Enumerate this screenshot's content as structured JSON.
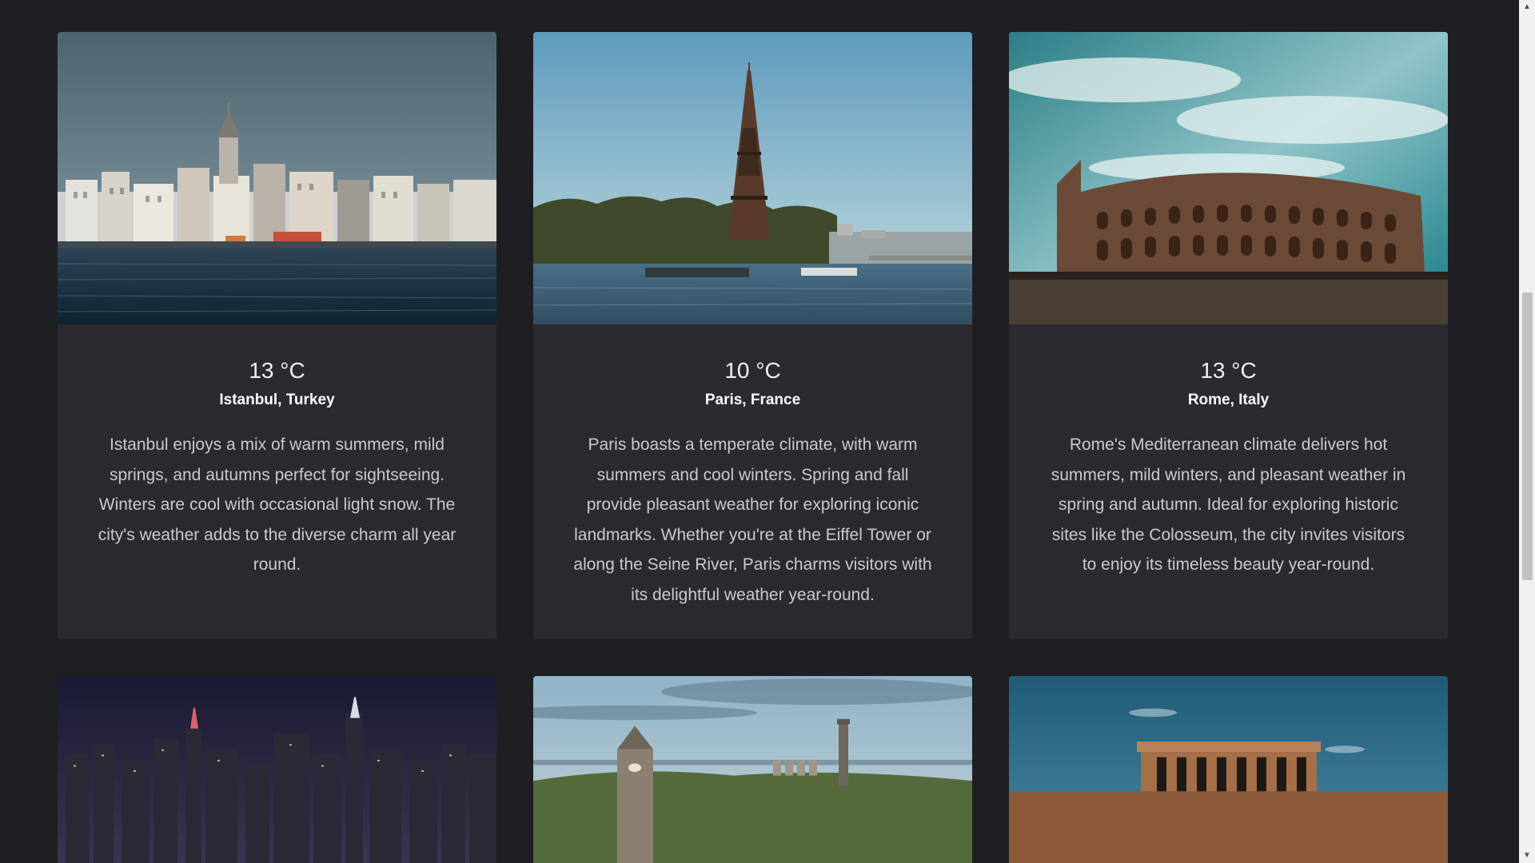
{
  "cards": [
    {
      "temperature": "13 °C",
      "city": "Istanbul, Turkey",
      "description": "Istanbul enjoys a mix of warm summers, mild springs, and autumns perfect for sightseeing. Winters are cool with occasional light snow. The city's weather adds to the diverse charm all year round."
    },
    {
      "temperature": "10 °C",
      "city": "Paris, France",
      "description": "Paris boasts a temperate climate, with warm summers and cool winters. Spring and fall provide pleasant weather for exploring iconic landmarks. Whether you're at the Eiffel Tower or along the Seine River, Paris charms visitors with its delightful weather year-round."
    },
    {
      "temperature": "13 °C",
      "city": "Rome, Italy",
      "description": "Rome's Mediterranean climate delivers hot summers, mild winters, and pleasant weather in spring and autumn. Ideal for exploring historic sites like the Colosseum, the city invites visitors to enjoy its timeless beauty year-round."
    }
  ],
  "scrollbar": {
    "up_arrow": "▲",
    "down_arrow": "▼"
  },
  "colors": {
    "page_background": "#1f1f23",
    "card_background": "#2a2a2f",
    "text_primary": "#ffffff",
    "text_secondary": "#c9c9ce"
  }
}
